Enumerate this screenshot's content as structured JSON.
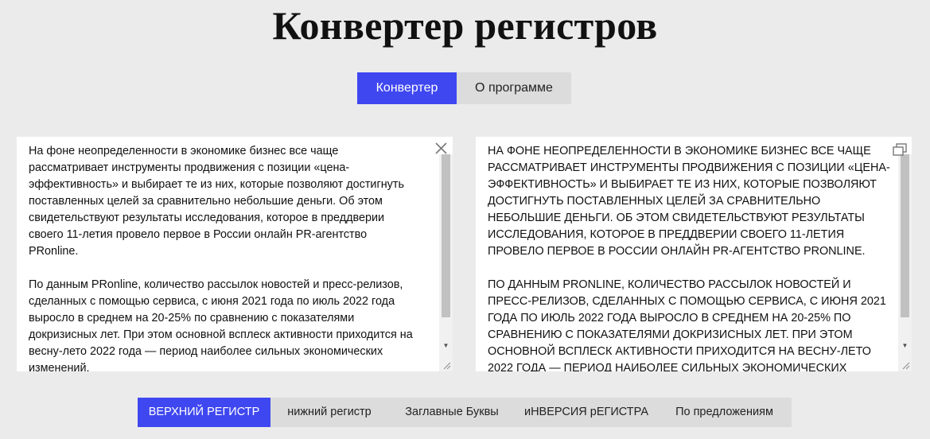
{
  "page": {
    "title": "Конвертер регистров"
  },
  "tabs": [
    {
      "label": "Конвертер",
      "active": true
    },
    {
      "label": "О программе",
      "active": false
    }
  ],
  "input": {
    "text": "На фоне неопределенности в экономике бизнес все чаще рассматривает инструменты продвижения с позиции «цена-эффективность» и выбирает те из них, которые позволяют достигнуть поставленных целей за сравнительно небольшие деньги. Об этом свидетельствуют результаты исследования, которое в преддверии своего 11-летия провело первое в России онлайн PR-агентство PRonline.\n\nПо данным PRonline, количество рассылок новостей и пресс-релизов, сделанных с помощью сервиса, с июня 2021 года по июль 2022 года выросло в среднем на 20-25% по сравнению с показателями докризисных лет. При этом основной всплеск активности приходится на весну-лето 2022 года — период наиболее сильных экономических изменений."
  },
  "output": {
    "text": "НА ФОНЕ НЕОПРЕДЕЛЕННОСТИ В ЭКОНОМИКЕ БИЗНЕС ВСЕ ЧАЩЕ РАССМАТРИВАЕТ ИНСТРУМЕНТЫ ПРОДВИЖЕНИЯ С ПОЗИЦИИ «ЦЕНА-ЭФФЕКТИВНОСТЬ» И ВЫБИРАЕТ ТЕ ИЗ НИХ, КОТОРЫЕ ПОЗВОЛЯЮТ ДОСТИГНУТЬ ПОСТАВЛЕННЫХ ЦЕЛЕЙ ЗА СРАВНИТЕЛЬНО НЕБОЛЬШИЕ ДЕНЬГИ. ОБ ЭТОМ СВИДЕТЕЛЬСТВУЮТ РЕЗУЛЬТАТЫ ИССЛЕДОВАНИЯ, КОТОРОЕ В ПРЕДДВЕРИИ СВОЕГО 11-ЛЕТИЯ ПРОВЕЛО ПЕРВОЕ В РОССИИ ОНЛАЙН PR-АГЕНТСТВО PRONLINE.\n\nПО ДАННЫМ PRONLINE, КОЛИЧЕСТВО РАССЫЛОК НОВОСТЕЙ И ПРЕСС-РЕЛИЗОВ, СДЕЛАННЫХ С ПОМОЩЬЮ СЕРВИСА, С ИЮНЯ 2021 ГОДА ПО ИЮЛЬ 2022 ГОДА ВЫРОСЛО В СРЕДНЕМ НА 20-25% ПО СРАВНЕНИЮ С ПОКАЗАТЕЛЯМИ ДОКРИЗИСНЫХ ЛЕТ. ПРИ ЭТОМ ОСНОВНОЙ ВСПЛЕСК АКТИВНОСТИ ПРИХОДИТСЯ НА ВЕСНУ-ЛЕТО 2022 ГОДА — ПЕРИОД НАИБОЛЕЕ СИЛЬНЫХ ЭКОНОМИЧЕСКИХ ИЗМЕНЕНИЙ."
  },
  "modes": [
    {
      "label": "ВЕРХНИЙ РЕГИСТР",
      "active": true
    },
    {
      "label": "нижний регистр",
      "active": false
    },
    {
      "label": "Заглавные Буквы",
      "active": false
    },
    {
      "label": "иНВЕРСИЯ рЕГИСТРА",
      "active": false
    },
    {
      "label": "По предложениям",
      "active": false
    }
  ],
  "icons": {
    "clear": "close-icon",
    "copy": "copy-icon"
  },
  "colors": {
    "accent": "#3f47f0",
    "background": "#ebebeb",
    "inactive_button": "#dcdcdc"
  }
}
